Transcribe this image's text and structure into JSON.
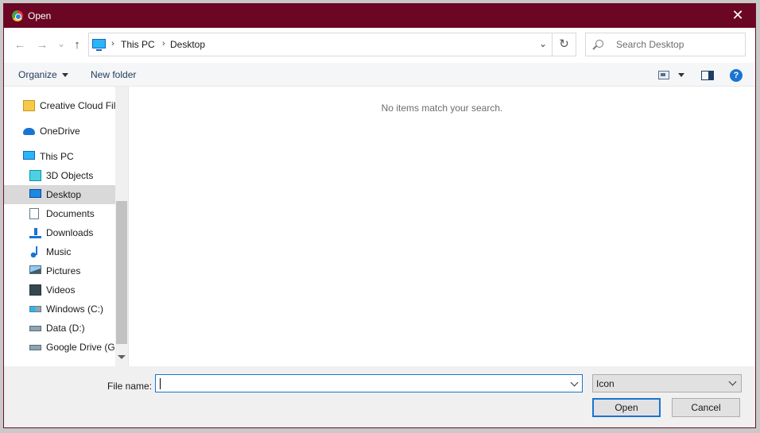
{
  "window": {
    "title": "Open",
    "close_glyph": "✕"
  },
  "address": {
    "back_glyph": "←",
    "forward_glyph": "→",
    "recent_glyph": "⌄",
    "up_glyph": "↑",
    "crumbs": [
      "This PC",
      "Desktop"
    ],
    "separator": "›",
    "refresh_glyph": "↻",
    "search_placeholder": "Search Desktop"
  },
  "toolbar": {
    "organize_label": "Organize",
    "new_folder_label": "New folder",
    "help_glyph": "?"
  },
  "nav": {
    "items": [
      {
        "label": "Creative Cloud Fil",
        "icon": "creative-cloud-icon"
      },
      {
        "label": "OneDrive",
        "icon": "cloud-icon"
      },
      {
        "label": "This PC",
        "icon": "computer-icon"
      },
      {
        "label": "3D Objects",
        "icon": "cube-icon"
      },
      {
        "label": "Desktop",
        "icon": "desktop-icon",
        "selected": true
      },
      {
        "label": "Documents",
        "icon": "document-icon"
      },
      {
        "label": "Downloads",
        "icon": "download-icon"
      },
      {
        "label": "Music",
        "icon": "music-icon"
      },
      {
        "label": "Pictures",
        "icon": "picture-icon"
      },
      {
        "label": "Videos",
        "icon": "video-icon"
      },
      {
        "label": "Windows (C:)",
        "icon": "drive-windows-icon"
      },
      {
        "label": "Data (D:)",
        "icon": "drive-icon"
      },
      {
        "label": "Google Drive (G:",
        "icon": "drive-icon"
      }
    ]
  },
  "content": {
    "empty_message": "No items match your search."
  },
  "footer": {
    "file_name_label": "File name:",
    "file_name_value": "",
    "file_type_value": "Icon",
    "open_label": "Open",
    "cancel_label": "Cancel"
  },
  "colors": {
    "titlebar": "#6b0625",
    "accent": "#1a74d2",
    "selected_row": "#d9d9d9"
  }
}
